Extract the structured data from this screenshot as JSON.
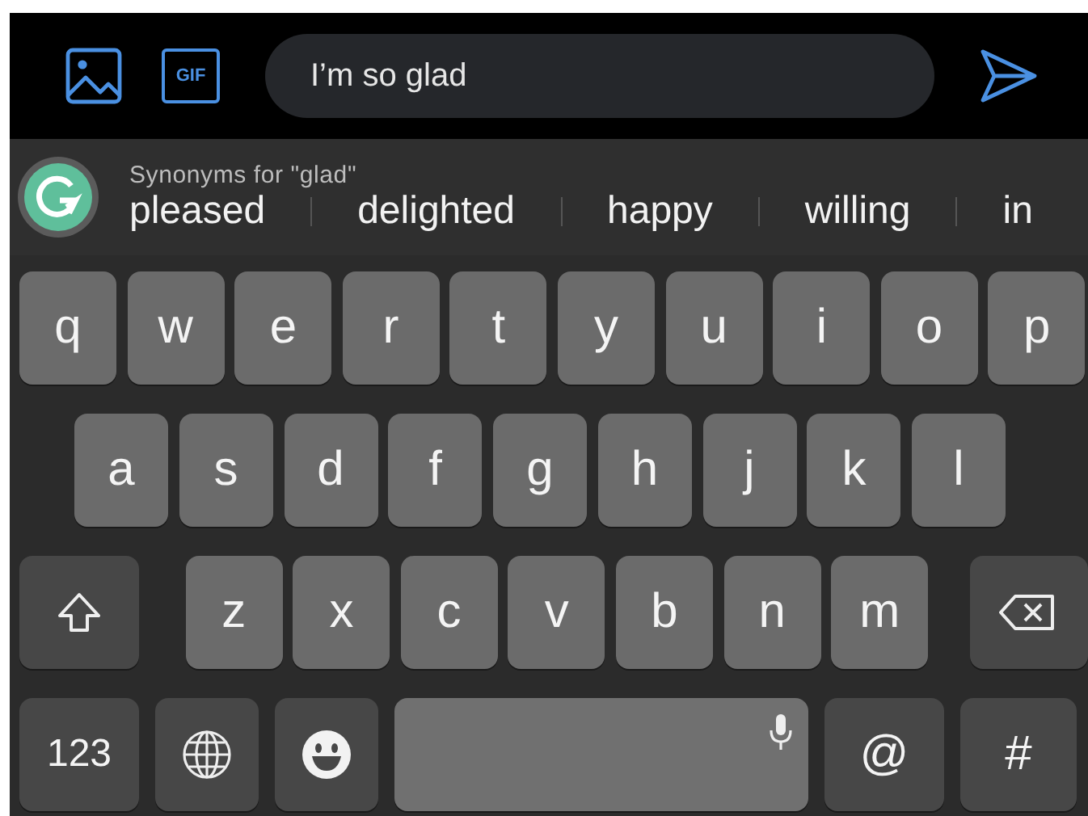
{
  "gif_button": {
    "label": "GIF"
  },
  "composer": {
    "value": "I’m so glad"
  },
  "suggestions": {
    "heading": "Synonyms for \"glad\"",
    "words": [
      "pleased",
      "delighted",
      "happy",
      "willing",
      "in"
    ]
  },
  "keyboard": {
    "rows": [
      [
        {
          "kind": "letter",
          "label": "q"
        },
        {
          "kind": "letter",
          "label": "w"
        },
        {
          "kind": "letter",
          "label": "e"
        },
        {
          "kind": "letter",
          "label": "r"
        },
        {
          "kind": "letter",
          "label": "t"
        },
        {
          "kind": "letter",
          "label": "y"
        },
        {
          "kind": "letter",
          "label": "u"
        },
        {
          "kind": "letter",
          "label": "i"
        },
        {
          "kind": "letter",
          "label": "o"
        },
        {
          "kind": "letter",
          "label": "p"
        }
      ],
      [
        {
          "kind": "letter",
          "label": "a"
        },
        {
          "kind": "letter",
          "label": "s"
        },
        {
          "kind": "letter",
          "label": "d"
        },
        {
          "kind": "letter",
          "label": "f"
        },
        {
          "kind": "letter",
          "label": "g"
        },
        {
          "kind": "letter",
          "label": "h"
        },
        {
          "kind": "letter",
          "label": "j"
        },
        {
          "kind": "letter",
          "label": "k"
        },
        {
          "kind": "letter",
          "label": "l"
        }
      ],
      [
        {
          "kind": "shift"
        },
        {
          "kind": "letter",
          "label": "z"
        },
        {
          "kind": "letter",
          "label": "x"
        },
        {
          "kind": "letter",
          "label": "c"
        },
        {
          "kind": "letter",
          "label": "v"
        },
        {
          "kind": "letter",
          "label": "b"
        },
        {
          "kind": "letter",
          "label": "n"
        },
        {
          "kind": "letter",
          "label": "m"
        },
        {
          "kind": "backspace"
        }
      ],
      [
        {
          "kind": "mode",
          "label": "123"
        },
        {
          "kind": "globe"
        },
        {
          "kind": "emoji"
        },
        {
          "kind": "space"
        },
        {
          "kind": "symbol",
          "label": "@"
        },
        {
          "kind": "symbol",
          "label": "#"
        }
      ]
    ]
  }
}
